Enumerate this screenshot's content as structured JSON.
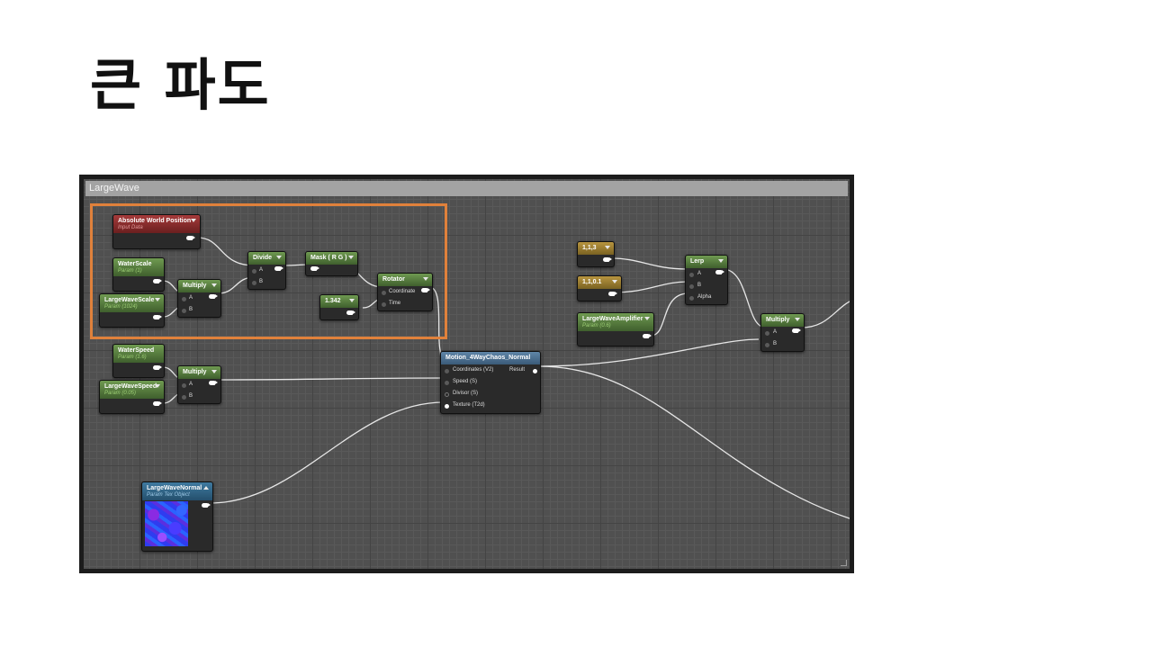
{
  "slide": {
    "title": "큰 파도"
  },
  "graph": {
    "comment_title": "LargeWave",
    "nodes": {
      "abs_world_pos": {
        "title": "Absolute World Position",
        "subtitle": "Input Data"
      },
      "water_scale": {
        "title": "WaterScale",
        "subtitle": "Param (1)"
      },
      "large_wave_scale": {
        "title": "LargeWaveScale",
        "subtitle": "Param (1024)"
      },
      "multiply_1": {
        "title": "Multiply",
        "pins": [
          "A",
          "B"
        ]
      },
      "divide": {
        "title": "Divide",
        "pins": [
          "A",
          "B"
        ]
      },
      "mask": {
        "title": "Mask ( R G )"
      },
      "const_1342": {
        "title": "1.342"
      },
      "rotator": {
        "title": "Rotator",
        "pins": [
          "Coordinate",
          "Time"
        ]
      },
      "water_speed": {
        "title": "WaterSpeed",
        "subtitle": "Param (1.6)"
      },
      "large_wave_speed": {
        "title": "LargeWaveSpeed",
        "subtitle": "Param (0.05)"
      },
      "multiply_2": {
        "title": "Multiply",
        "pins": [
          "A",
          "B"
        ]
      },
      "motion": {
        "title": "Motion_4WayChaos_Normal",
        "pins": [
          "Coordinates (V2)",
          "Speed (S)",
          "Divisor (S)",
          "Texture (T2d)"
        ],
        "output": "Result"
      },
      "large_wave_normal": {
        "title": "LargeWaveNormal",
        "subtitle": "Param Tex Object"
      },
      "vec_113": {
        "title": "1,1,3"
      },
      "vec_1101": {
        "title": "1,1,0.1"
      },
      "lerp": {
        "title": "Lerp",
        "pins": [
          "A",
          "B",
          "Alpha"
        ]
      },
      "amplifier": {
        "title": "LargeWaveAmplifier",
        "subtitle": "Param (0.6)"
      },
      "multiply_3": {
        "title": "Multiply",
        "pins": [
          "A",
          "B"
        ]
      }
    }
  },
  "colors": {
    "highlight": "#e0813b",
    "param_node": "#5a8a3e",
    "input_node": "#8f2e2e",
    "constant_node": "#9c7f30",
    "function_node": "#4f7698",
    "texture_node": "#2f6a92"
  }
}
